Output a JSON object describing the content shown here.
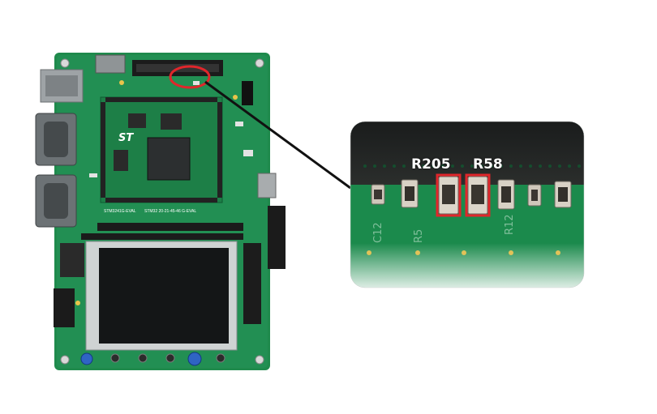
{
  "board": {
    "silkscreen_left": "STM3241G-EVAL",
    "silkscreen_right": "STM32 20-21-45-46 G-EVAL"
  },
  "zoom_view": {
    "callouts": [
      {
        "label": "R205"
      },
      {
        "label": "R58"
      }
    ]
  },
  "colors": {
    "pcb_green": "#1f8a4c",
    "highlight_red": "#e0262b",
    "connector_line": "#111111"
  }
}
